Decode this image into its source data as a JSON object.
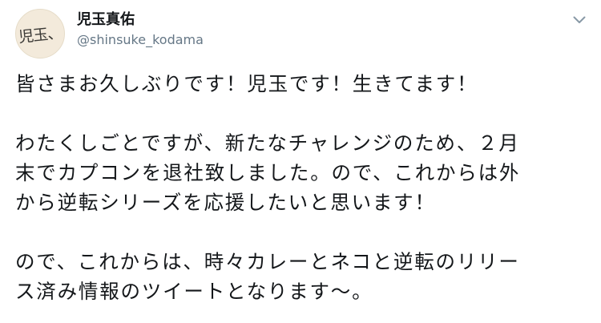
{
  "tweet": {
    "author": {
      "display_name": "児玉真佑",
      "handle": "@shinsuke_kodama",
      "avatar_text": "児玉、"
    },
    "menu_icon": "chevron-down-icon",
    "lines": [
      "皆さまお久しぶりです！児玉です！生きてます！",
      "わたくしごとですが、新たなチャレンジのため、２月",
      "末でカプコンを退社致しました。ので、これからは外",
      "から逆転シリーズを応援したいと思います！",
      "ので、これからは、時々カレーとネコと逆転のリリー",
      "ス済み情報のツイートとなります〜。"
    ]
  }
}
